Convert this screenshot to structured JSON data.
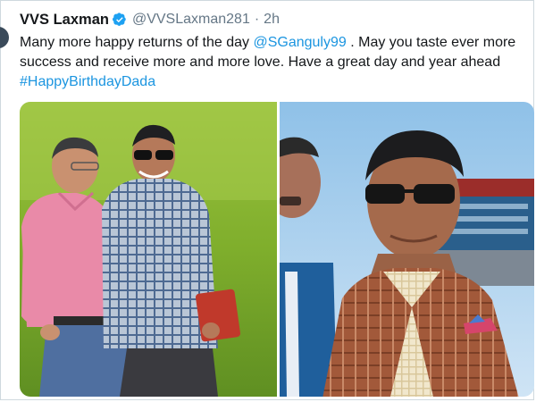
{
  "tweet": {
    "author_name": "VVS Laxman",
    "author_handle": "@VVSLaxman281",
    "separator": "·",
    "time": "2h",
    "text_before": "Many more happy returns of the day ",
    "mention": "@SGanguly99",
    "text_middle": " . May you taste ever more success and receive more and more love. Have a great day and year ahead ",
    "hashtag": "#HappyBirthdayDada"
  },
  "colors": {
    "link": "#1b95e0",
    "verified_badge": "#1da1f2",
    "secondary_text": "#657786"
  },
  "icons": {
    "verified": "verified-badge-icon"
  }
}
